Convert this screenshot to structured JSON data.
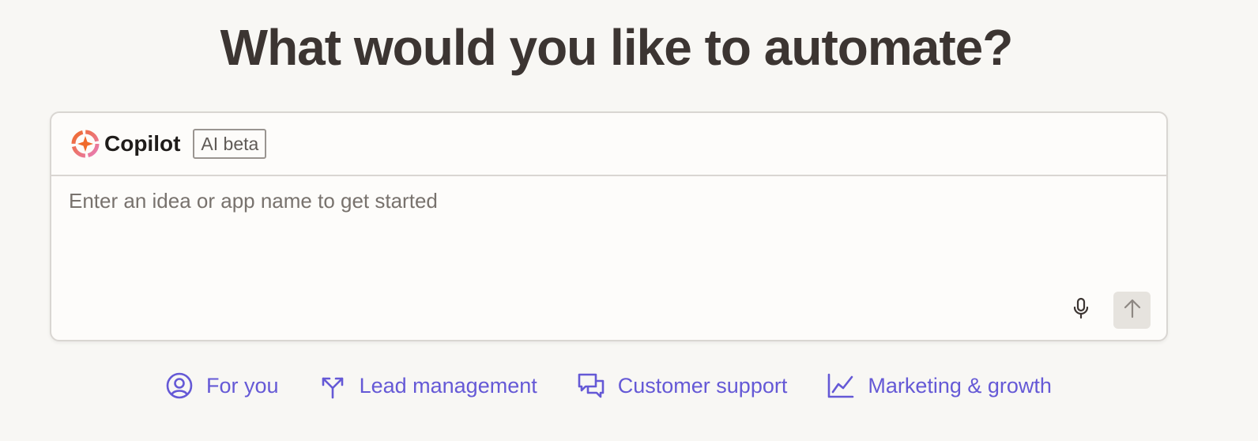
{
  "page": {
    "headline": "What would you like to automate?"
  },
  "copilot": {
    "name": "Copilot",
    "badge": "AI beta",
    "logo_icon": "copilot-sparkle-icon"
  },
  "prompt": {
    "placeholder": "Enter an idea or app name to get started",
    "value": ""
  },
  "actions": {
    "mic_icon": "microphone-icon",
    "send_icon": "arrow-up-icon"
  },
  "categories": [
    {
      "label": "For you",
      "icon": "user-circle-icon"
    },
    {
      "label": "Lead management",
      "icon": "split-arrows-icon"
    },
    {
      "label": "Customer support",
      "icon": "chat-bubbles-icon"
    },
    {
      "label": "Marketing & growth",
      "icon": "line-chart-icon"
    }
  ],
  "colors": {
    "background": "#f8f7f4",
    "headline": "#3c3532",
    "accent": "#6559d6",
    "logo_orange": "#f06b2b",
    "logo_pink": "#e87db8"
  }
}
